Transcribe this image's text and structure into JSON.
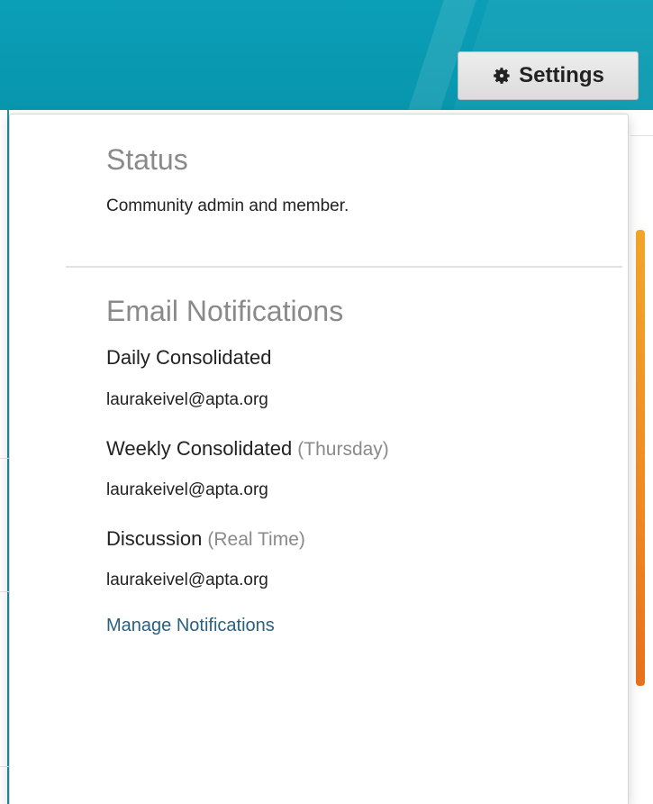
{
  "header": {
    "settings_label": "Settings",
    "settings_icon": "gear-icon"
  },
  "status": {
    "title": "Status",
    "text": "Community admin and member."
  },
  "email_notifications": {
    "title": "Email Notifications",
    "items": [
      {
        "label": "Daily Consolidated",
        "sub": "",
        "email": "laurakeivel@apta.org"
      },
      {
        "label": "Weekly Consolidated",
        "sub": "(Thursday)",
        "email": "laurakeivel@apta.org"
      },
      {
        "label": "Discussion",
        "sub": "(Real Time)",
        "email": "laurakeivel@apta.org"
      }
    ],
    "manage_link": "Manage Notifications"
  },
  "colors": {
    "banner": "#0b9fb7",
    "link": "#2a6080",
    "muted": "#8a8a8a",
    "accent_orange": "#ef8a24"
  }
}
